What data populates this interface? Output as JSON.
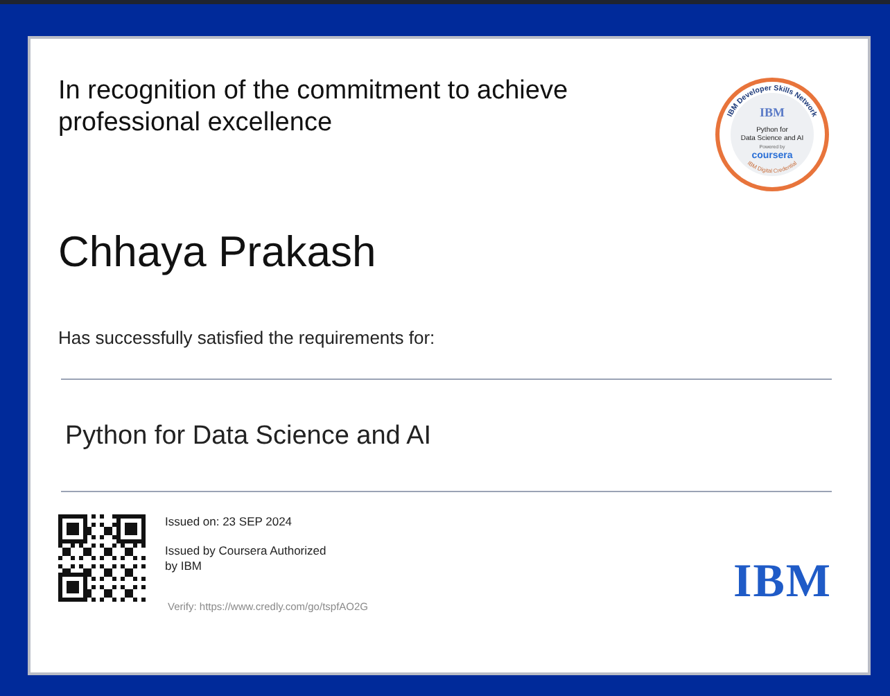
{
  "certificate": {
    "recognition": "In recognition of the commitment to achieve professional excellence",
    "badge": {
      "arc_text": "IBM Developer Skills Network",
      "logo": "IBM",
      "course": "Python for Data Science and AI",
      "powered": "Powered by",
      "brand": "coursera",
      "footer": "IBM Digital Credential"
    },
    "recipient": "Chhaya Prakash",
    "statement": "Has successfully satisfied the requirements for:",
    "course": "Python for Data Science and AI",
    "issued_on": "Issued on: 23 SEP 2024",
    "issued_by": "Issued by Coursera Authorized by IBM",
    "verify": "Verify: https://www.credly.com/go/tspfAO2G",
    "logo": "IBM"
  }
}
